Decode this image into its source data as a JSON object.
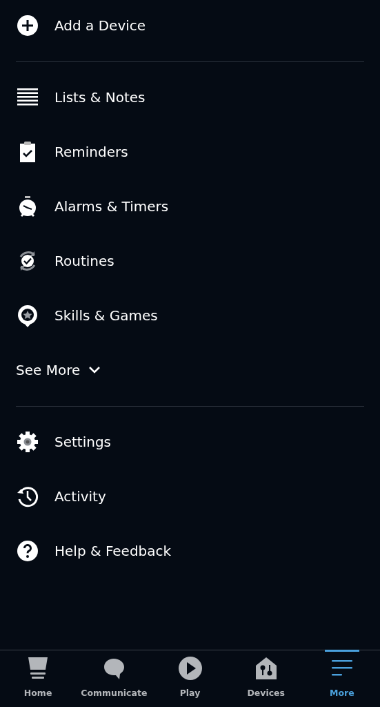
{
  "sections": [
    {
      "items": [
        {
          "label": "Add a Device"
        }
      ]
    },
    {
      "items": [
        {
          "label": "Lists & Notes"
        },
        {
          "label": "Reminders"
        },
        {
          "label": "Alarms & Timers"
        },
        {
          "label": "Routines"
        },
        {
          "label": "Skills & Games"
        }
      ],
      "see_more": {
        "label": "See More",
        "expanded": false
      }
    },
    {
      "items": [
        {
          "label": "Settings"
        },
        {
          "label": "Activity"
        },
        {
          "label": "Help & Feedback"
        }
      ]
    }
  ],
  "tab_bar": [
    {
      "label": "Home",
      "selected": false
    },
    {
      "label": "Communicate",
      "selected": false
    },
    {
      "label": "Play",
      "selected": false
    },
    {
      "label": "Devices",
      "selected": false
    },
    {
      "label": "More",
      "selected": true
    }
  ]
}
